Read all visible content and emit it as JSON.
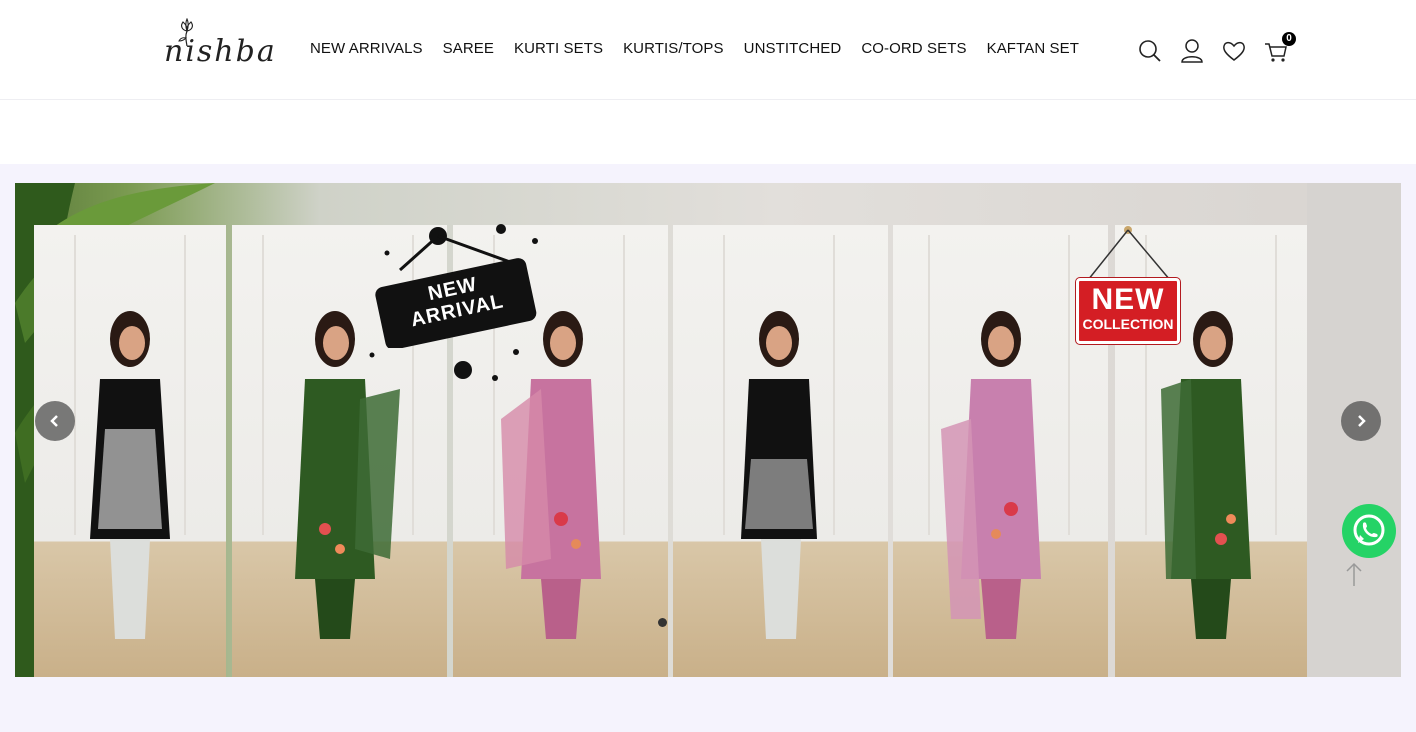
{
  "brand": {
    "logo_text": "nishba"
  },
  "nav": {
    "items": [
      {
        "label": "NEW ARRIVALS"
      },
      {
        "label": "SAREE"
      },
      {
        "label": "KURTI SETS"
      },
      {
        "label": "KURTIS/TOPS"
      },
      {
        "label": "UNSTITCHED"
      },
      {
        "label": "CO-ORD SETS"
      },
      {
        "label": "KAFTAN SET"
      }
    ]
  },
  "header_icons": {
    "search": "search-icon",
    "account": "user-icon",
    "wishlist": "heart-icon",
    "cart": "cart-icon",
    "cart_count": "0"
  },
  "hero": {
    "sign_left_line1": "NEW",
    "sign_left_line2": "ARRIVAL",
    "sign_right_line1": "NEW",
    "sign_right_line2": "COLLECTION",
    "prev_icon": "chevron-left-icon",
    "next_icon": "chevron-right-icon"
  },
  "floating": {
    "whatsapp_icon": "whatsapp-icon",
    "scroll_top_icon": "arrow-up-icon"
  },
  "colors": {
    "band_bg": "#f5f3fd",
    "whatsapp": "#25d366",
    "sign_black": "#111111",
    "sign_red": "#d41e24"
  }
}
